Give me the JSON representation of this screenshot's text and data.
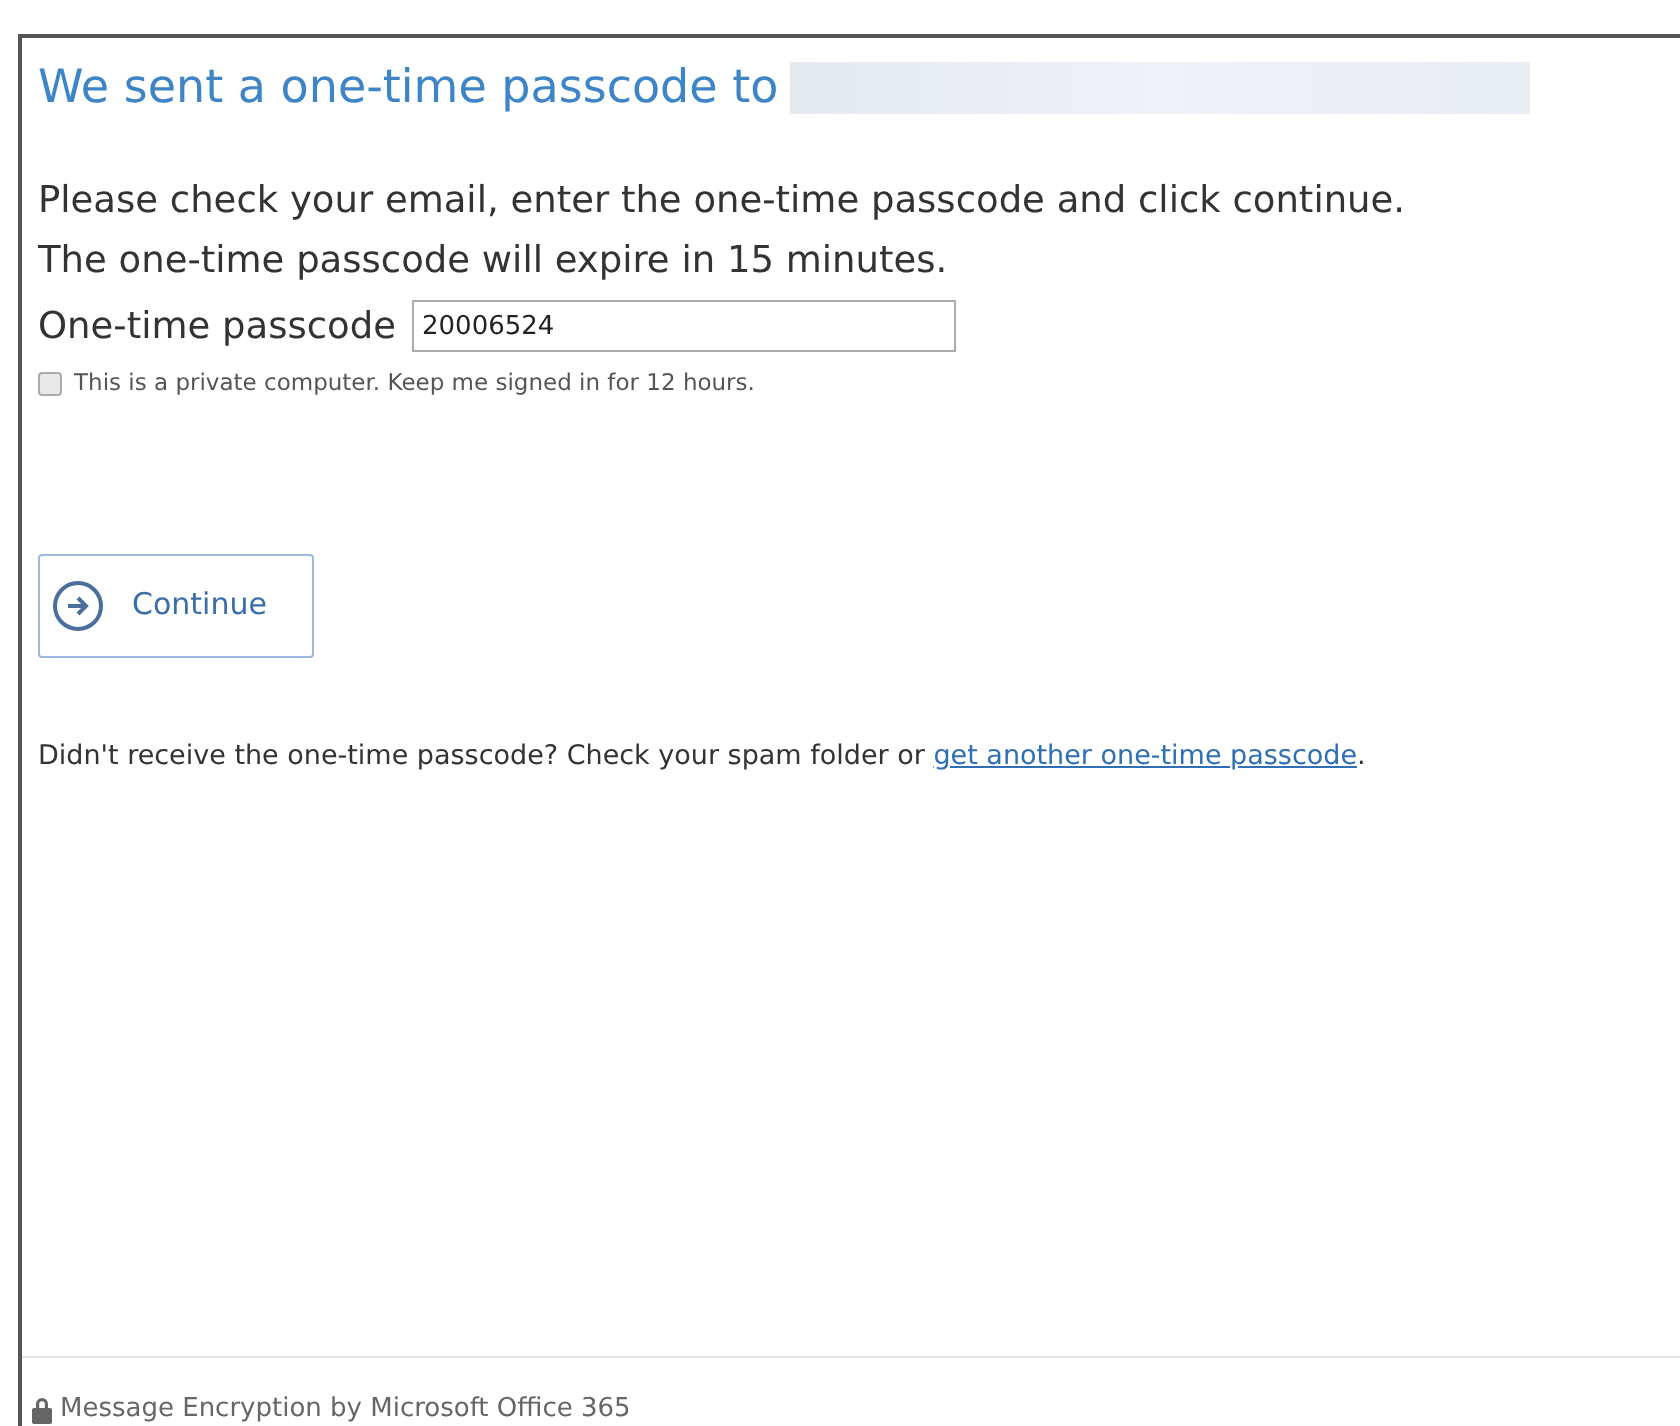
{
  "heading": {
    "text": "We sent a one-time passcode to"
  },
  "instructions": [
    "Please check your email, enter the one-time passcode and click continue.",
    "The one-time passcode will expire in 15 minutes."
  ],
  "passcode": {
    "label": "One-time passcode",
    "value": "20006524"
  },
  "keep_signed_in": {
    "label": "This is a private computer. Keep me signed in for 12 hours.",
    "checked": false
  },
  "continue_button": {
    "label": "Continue"
  },
  "help": {
    "text": "Didn't receive the one-time passcode? Check your spam folder or ",
    "link": "get another one-time passcode",
    "after": "."
  },
  "footer": {
    "text": "Message Encryption by Microsoft Office 365"
  }
}
